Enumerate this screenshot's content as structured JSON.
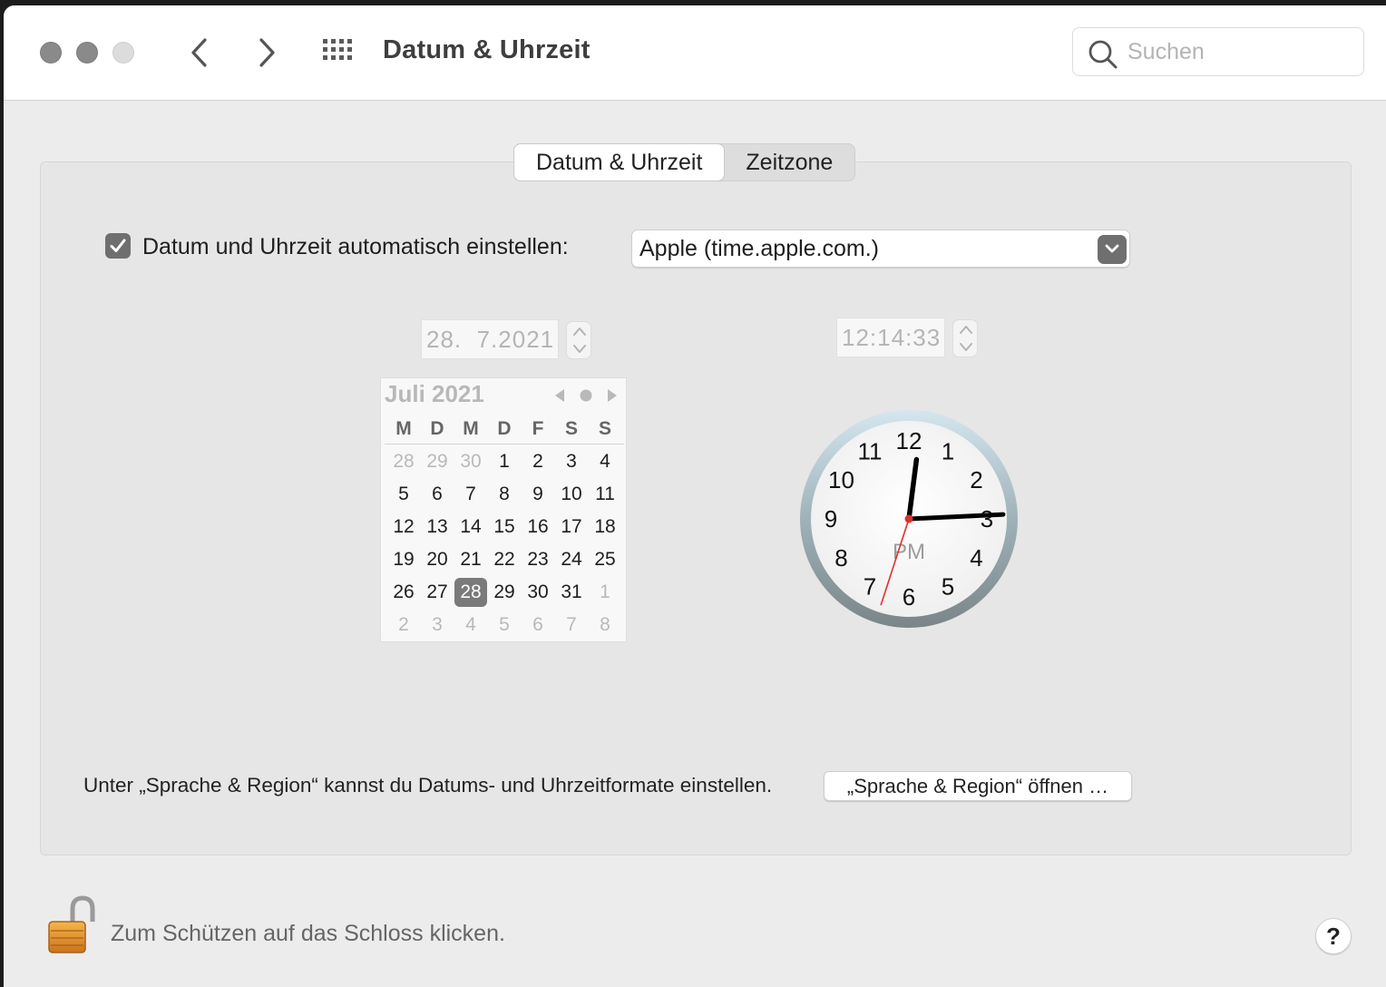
{
  "window": {
    "title": "Datum & Uhrzeit",
    "search_placeholder": "Suchen"
  },
  "tabs": [
    {
      "label": "Datum & Uhrzeit",
      "active": true
    },
    {
      "label": "Zeitzone",
      "active": false
    }
  ],
  "auto_set": {
    "label": "Datum und Uhrzeit automatisch einstellen:",
    "checked": true,
    "server": "Apple (time.apple.com.)"
  },
  "date_field": "28.  7.2021",
  "time_field": "12:14:33",
  "calendar": {
    "month_label": "Juli 2021",
    "weekdays": [
      "M",
      "D",
      "M",
      "D",
      "F",
      "S",
      "S"
    ],
    "selected_day": "28",
    "weeks": [
      [
        "28",
        "29",
        "30",
        "1",
        "2",
        "3",
        "4"
      ],
      [
        "5",
        "6",
        "7",
        "8",
        "9",
        "10",
        "11"
      ],
      [
        "12",
        "13",
        "14",
        "15",
        "16",
        "17",
        "18"
      ],
      [
        "19",
        "20",
        "21",
        "22",
        "23",
        "24",
        "25"
      ],
      [
        "26",
        "27",
        "28",
        "29",
        "30",
        "31",
        "1"
      ],
      [
        "2",
        "3",
        "4",
        "5",
        "6",
        "7",
        "8"
      ]
    ],
    "muted": [
      [
        true,
        true,
        true,
        false,
        false,
        false,
        false
      ],
      [
        false,
        false,
        false,
        false,
        false,
        false,
        false
      ],
      [
        false,
        false,
        false,
        false,
        false,
        false,
        false
      ],
      [
        false,
        false,
        false,
        false,
        false,
        false,
        false
      ],
      [
        false,
        false,
        false,
        false,
        false,
        false,
        true
      ],
      [
        true,
        true,
        true,
        true,
        true,
        true,
        true
      ]
    ]
  },
  "clock": {
    "numbers": [
      "12",
      "1",
      "2",
      "3",
      "4",
      "5",
      "6",
      "7",
      "8",
      "9",
      "10",
      "11"
    ],
    "ampm": "PM",
    "hours": 12,
    "minutes": 14,
    "seconds": 33
  },
  "region": {
    "text": "Unter „Sprache & Region“ kannst du Datums- und Uhrzeitformate einstellen.",
    "button_label": "„Sprache & Region“ öffnen …"
  },
  "lock": {
    "text": "Zum Schützen auf das Schloss klicken."
  },
  "help_label": "?",
  "colors": {
    "accent_gray": "#6f6f6f",
    "second_hand": "#e0302a"
  }
}
